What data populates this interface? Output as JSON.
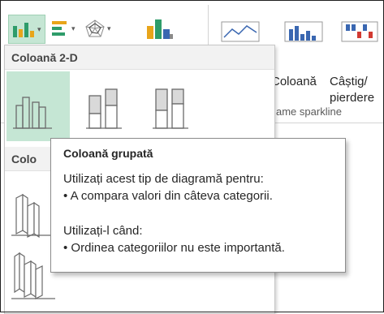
{
  "gallery": {
    "section_2d": "Coloană 2-D",
    "section_3d_partial": "Colo"
  },
  "ribbon": {
    "sparkline_column": "Coloană",
    "sparkline_winloss_1": "Câștig/",
    "sparkline_winloss_2": "pierdere",
    "group_label_partial": "ame sparkline"
  },
  "tooltip": {
    "title": "Coloană grupată",
    "line1": "Utilizați acest tip de diagramă pentru:",
    "line2": "• A compara valori din câteva categorii.",
    "line3": "Utilizați-l când:",
    "line4": "• Ordinea categoriilor nu este importantă."
  },
  "colors": {
    "accent_green": "#c5e6d4",
    "chart_teal": "#2e9c6a",
    "chart_gold": "#e8a51a",
    "chart_blue": "#3a67b1",
    "chart_red": "#d23a32"
  },
  "icons": [
    "column-chart-icon",
    "bar-chart-icon",
    "radar-chart-icon",
    "waterfall-chart-icon",
    "line-sparkline-icon",
    "column-sparkline-icon",
    "winloss-sparkline-icon"
  ]
}
